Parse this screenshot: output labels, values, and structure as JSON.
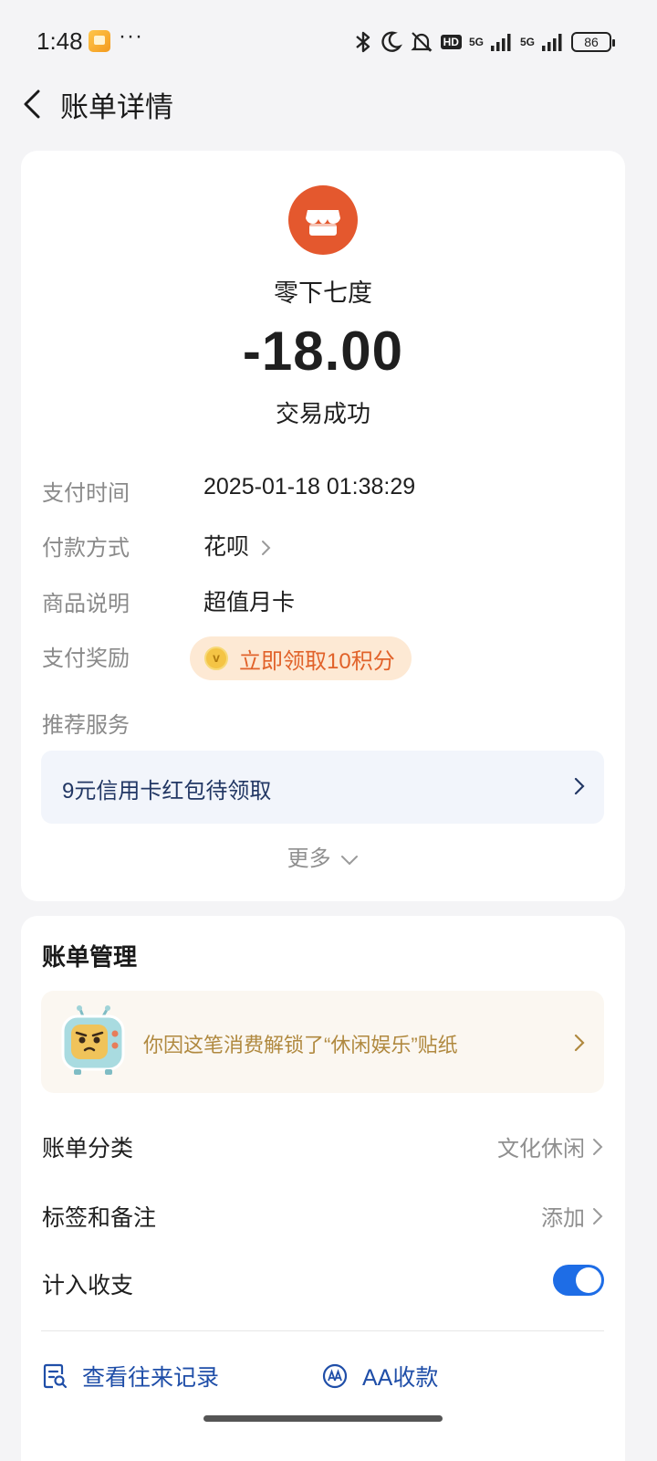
{
  "status_bar": {
    "time": "1:48",
    "more": "···",
    "hd": "HD",
    "network_1": "5G",
    "network_2": "5G",
    "battery": "86"
  },
  "header": {
    "title": "账单详情"
  },
  "detail": {
    "merchant_name": "零下七度",
    "amount": "-18.00",
    "status": "交易成功",
    "pay_time_label": "支付时间",
    "pay_time": "2025-01-18 01:38:29",
    "pay_method_label": "付款方式",
    "pay_method": "花呗",
    "product_label": "商品说明",
    "product": "超值月卡",
    "reward_label": "支付奖励",
    "reward": "立即领取10积分",
    "recommend_label": "推荐服务",
    "service_banner": "9元信用卡红包待领取",
    "more": "更多"
  },
  "manage": {
    "title": "账单管理",
    "sticker_text": "你因这笔消费解锁了“休闲娱乐”贴纸",
    "category_label": "账单分类",
    "category_value": "文化休闲",
    "tag_label": "标签和备注",
    "tag_value": "添加",
    "include_label": "计入收支",
    "include_enabled": true,
    "action_history": "查看往来记录",
    "action_aa": "AA收款"
  },
  "colors": {
    "accent_blue": "#1e6de6",
    "merchant_logo": "#e4582e",
    "reward_text": "#e1622a"
  }
}
